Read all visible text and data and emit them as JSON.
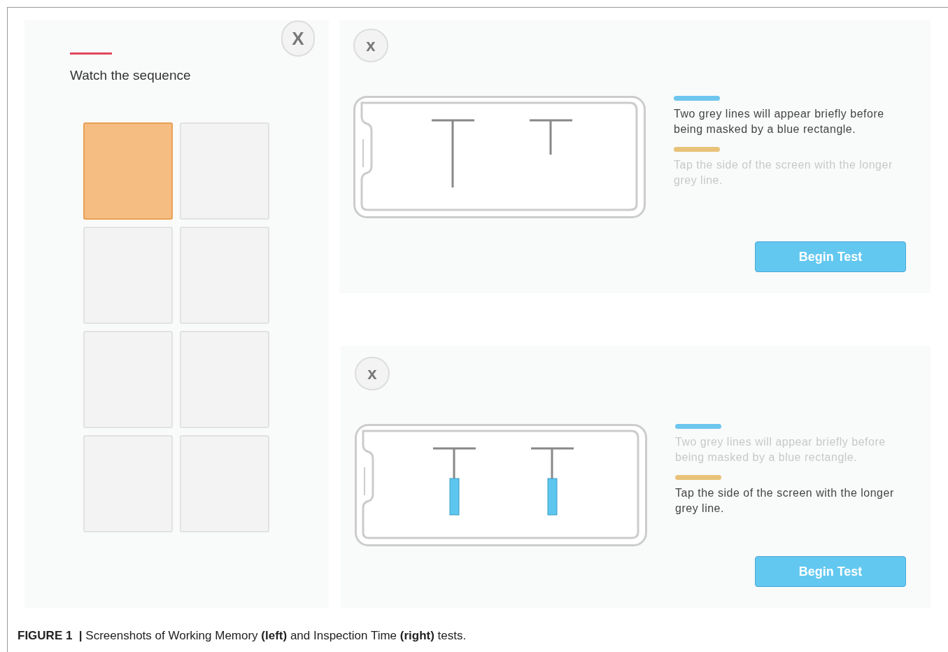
{
  "left_screen": {
    "close_label": "X",
    "instruction": "Watch the sequence",
    "tiles": [
      {
        "lit": true
      },
      {
        "lit": false
      },
      {
        "lit": false
      },
      {
        "lit": false
      },
      {
        "lit": false
      },
      {
        "lit": false
      },
      {
        "lit": false
      },
      {
        "lit": false
      }
    ]
  },
  "right_screens": [
    {
      "close_label": "x",
      "masked": false,
      "steps": [
        {
          "text": "Two grey lines will appear briefly before being masked by a blue rectangle.",
          "active": true,
          "color": "#6ec6ee"
        },
        {
          "text": "Tap the side of the screen with the longer grey line.",
          "active": false,
          "color": "#e9c27a"
        }
      ],
      "button": "Begin Test"
    },
    {
      "close_label": "x",
      "masked": true,
      "steps": [
        {
          "text": "Two grey lines will appear briefly before being masked by a blue rectangle.",
          "active": false,
          "color": "#6ec6ee"
        },
        {
          "text": "Tap the side of the screen with the longer grey line.",
          "active": true,
          "color": "#e9c27a"
        }
      ],
      "button": "Begin Test"
    }
  ],
  "caption": "**FIGURE 1  |** Screenshots of Working Memory **(left)** and Inspection Time **(right)** tests."
}
